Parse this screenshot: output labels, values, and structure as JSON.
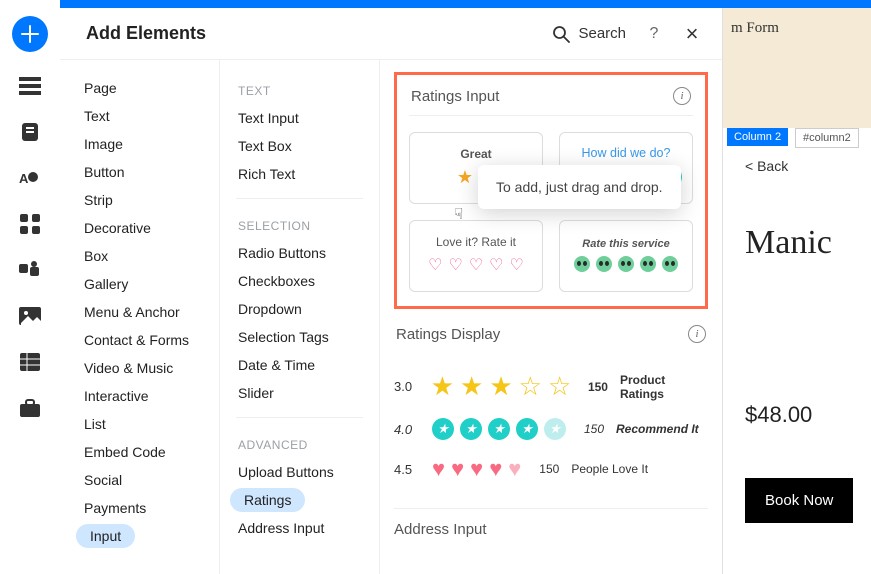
{
  "header": {
    "title": "Add Elements",
    "search": "Search",
    "help": "?",
    "close": "×"
  },
  "col1": {
    "items": [
      "Page",
      "Text",
      "Image",
      "Button",
      "Strip",
      "Decorative",
      "Box",
      "Gallery",
      "Menu & Anchor",
      "Contact & Forms",
      "Video & Music",
      "Interactive",
      "List",
      "Embed Code",
      "Social",
      "Payments",
      "Input"
    ],
    "selected": "Input"
  },
  "col2": {
    "groups": [
      {
        "label": "TEXT",
        "items": [
          "Text Input",
          "Text Box",
          "Rich Text"
        ]
      },
      {
        "label": "SELECTION",
        "items": [
          "Radio Buttons",
          "Checkboxes",
          "Dropdown",
          "Selection Tags",
          "Date & Time",
          "Slider"
        ]
      },
      {
        "label": "ADVANCED",
        "items": [
          "Upload Buttons",
          "Ratings",
          "Address Input"
        ]
      }
    ],
    "selected": "Ratings"
  },
  "ratings_input": {
    "title": "Ratings Input",
    "tooltip": "To add, just drag and drop.",
    "cards": [
      {
        "label": "Great",
        "style": "bold"
      },
      {
        "label": "How did we do?",
        "style": "blue"
      },
      {
        "label": "Love it? Rate it",
        "style": "plain"
      },
      {
        "label": "Rate this service",
        "style": "ital"
      }
    ]
  },
  "ratings_display": {
    "title": "Ratings Display",
    "rows": [
      {
        "score": "3.0",
        "count": "150",
        "label": "Product Ratings"
      },
      {
        "score": "4.0",
        "count": "150",
        "label": "Recommend It"
      },
      {
        "score": "4.5",
        "count": "150",
        "label": "People Love It"
      }
    ]
  },
  "address_input": {
    "title": "Address Input"
  },
  "canvas": {
    "form_label": "m Form",
    "column_tag": "Column 2",
    "column_id": "#column2",
    "back": "<  Back",
    "product_title": "Manic",
    "price": "$48.00",
    "book": "Book Now"
  }
}
